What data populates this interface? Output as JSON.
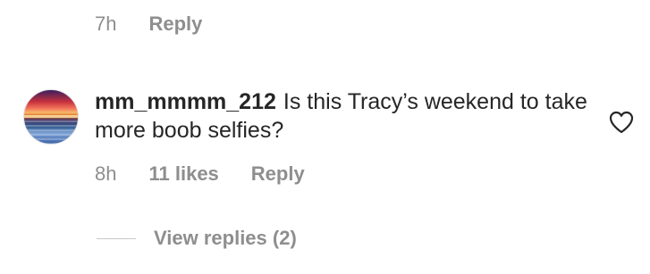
{
  "previous_comment_meta": {
    "time": "7h",
    "reply_label": "Reply"
  },
  "comment": {
    "avatar_icon": "sunset-avatar-icon",
    "username": "mm_mmmm_212",
    "text": "Is this Tracy’s weekend to take more boob selfies?",
    "time": "8h",
    "likes": "11 likes",
    "reply_label": "Reply",
    "like_icon": "heart-outline-icon"
  },
  "view_replies": {
    "label": "View replies (2)"
  },
  "colors": {
    "text": "#262626",
    "secondary": "#8e8e8e",
    "divider": "#c7c7c7",
    "background": "#ffffff"
  }
}
